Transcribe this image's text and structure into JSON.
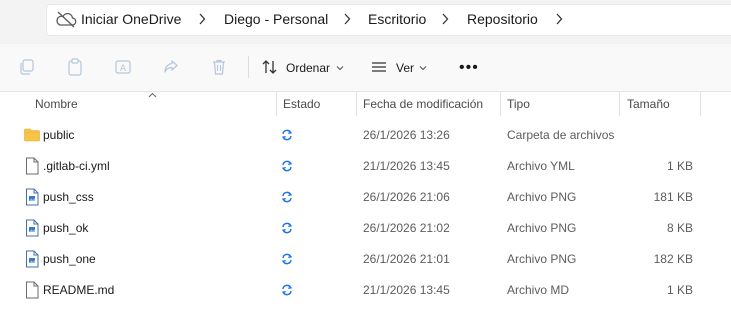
{
  "address": {
    "breadcrumbs": [
      "Iniciar OneDrive",
      "Diego - Personal",
      "Escritorio",
      "Repositorio"
    ]
  },
  "toolbar": {
    "icons": [
      "copy-icon",
      "paste-icon",
      "rename-icon",
      "share-icon",
      "delete-icon"
    ],
    "sort_label": "Ordenar",
    "view_label": "Ver",
    "more_label": "•••"
  },
  "columns": {
    "name": "Nombre",
    "status": "Estado",
    "modified": "Fecha de modificación",
    "type": "Tipo",
    "size": "Tamaño"
  },
  "files": [
    {
      "name": "public",
      "date": "26/1/2026 13:26",
      "type": "Carpeta de archivos",
      "size": "",
      "icon": "folder-icon"
    },
    {
      "name": ".gitlab-ci.yml",
      "date": "21/1/2026 13:45",
      "type": "Archivo YML",
      "size": "1 KB",
      "icon": "file-icon"
    },
    {
      "name": "push_css",
      "date": "26/1/2026 21:06",
      "type": "Archivo PNG",
      "size": "181 KB",
      "icon": "image-file-icon"
    },
    {
      "name": "push_ok",
      "date": "26/1/2026 21:02",
      "type": "Archivo PNG",
      "size": "8 KB",
      "icon": "image-file-icon"
    },
    {
      "name": "push_one",
      "date": "26/1/2026 21:01",
      "type": "Archivo PNG",
      "size": "182 KB",
      "icon": "image-file-icon"
    },
    {
      "name": "README.md",
      "date": "21/1/2026 13:45",
      "type": "Archivo MD",
      "size": "1 KB",
      "icon": "file-icon"
    }
  ],
  "colors": {
    "accent": "#0067c0",
    "folder": "#f8c443",
    "sync": "#1a73e8"
  }
}
